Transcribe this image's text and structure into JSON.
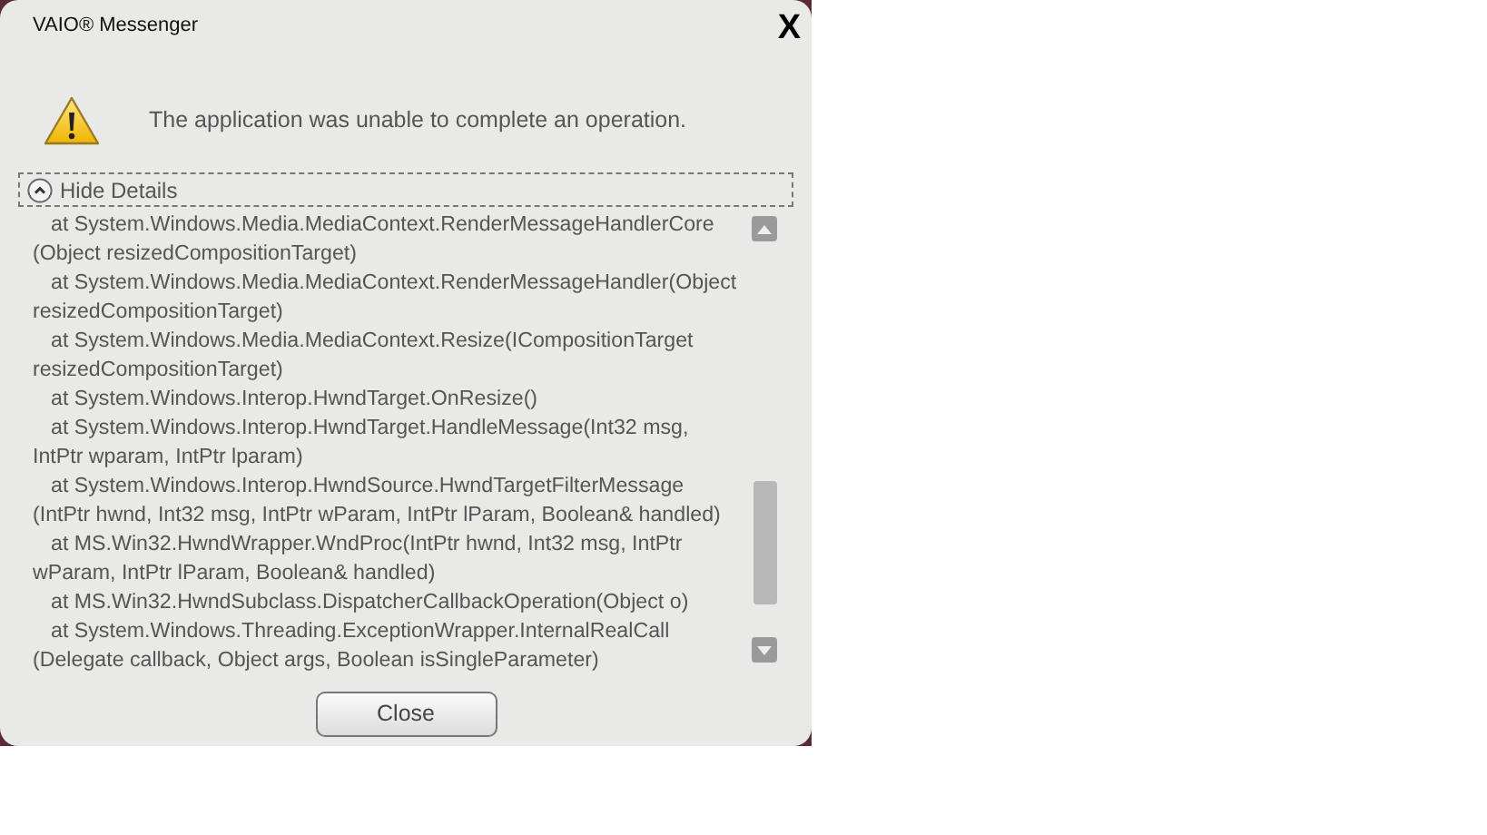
{
  "window": {
    "title": "VAIO® Messenger",
    "close_label": "X"
  },
  "message": "The application was unable to complete an operation.",
  "details_toggle": {
    "label": "Hide Details",
    "expanded": true
  },
  "details_lines": [
    {
      "kind": "frame",
      "text": "at System.Windows.Media.MediaContext.RenderMessageHandlerCore"
    },
    {
      "kind": "wrap",
      "text": "(Object resizedCompositionTarget)"
    },
    {
      "kind": "frame",
      "text": "at System.Windows.Media.MediaContext.RenderMessageHandler(Object"
    },
    {
      "kind": "wrap",
      "text": "resizedCompositionTarget)"
    },
    {
      "kind": "frame",
      "text": "at System.Windows.Media.MediaContext.Resize(ICompositionTarget"
    },
    {
      "kind": "wrap",
      "text": "resizedCompositionTarget)"
    },
    {
      "kind": "frame",
      "text": "at System.Windows.Interop.HwndTarget.OnResize()"
    },
    {
      "kind": "frame",
      "text": "at System.Windows.Interop.HwndTarget.HandleMessage(Int32 msg,"
    },
    {
      "kind": "wrap",
      "text": "IntPtr wparam, IntPtr lparam)"
    },
    {
      "kind": "frame",
      "text": "at System.Windows.Interop.HwndSource.HwndTargetFilterMessage"
    },
    {
      "kind": "wrap",
      "text": "(IntPtr hwnd, Int32 msg, IntPtr wParam, IntPtr lParam, Boolean& handled)"
    },
    {
      "kind": "frame",
      "text": "at MS.Win32.HwndWrapper.WndProc(IntPtr hwnd, Int32 msg, IntPtr"
    },
    {
      "kind": "wrap",
      "text": "wParam, IntPtr lParam, Boolean& handled)"
    },
    {
      "kind": "frame",
      "text": "at MS.Win32.HwndSubclass.DispatcherCallbackOperation(Object o)"
    },
    {
      "kind": "frame",
      "text": "at System.Windows.Threading.ExceptionWrapper.InternalRealCall"
    },
    {
      "kind": "wrap",
      "text": "(Delegate callback, Object args, Boolean isSingleParameter)"
    }
  ],
  "buttons": [
    "Close"
  ]
}
